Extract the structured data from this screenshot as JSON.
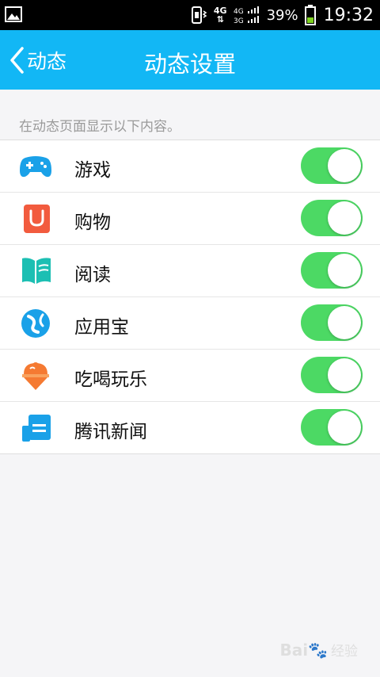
{
  "status_bar": {
    "network_top": "4G",
    "signal_4g": "4G",
    "signal_3g": "3G",
    "battery": "39%",
    "time": "19:32"
  },
  "header": {
    "back_label": "动态",
    "title": "动态设置"
  },
  "hint": "在动态页面显示以下内容。",
  "items": [
    {
      "label": "游戏",
      "icon": "gamepad-icon",
      "color": "#1aa1e8",
      "enabled": true
    },
    {
      "label": "购物",
      "icon": "shopping-bag-icon",
      "color": "#f25b3e",
      "enabled": true
    },
    {
      "label": "阅读",
      "icon": "book-icon",
      "color": "#1cbfb3",
      "enabled": true
    },
    {
      "label": "应用宝",
      "icon": "app-store-icon",
      "color": "#1aa1e8",
      "enabled": true
    },
    {
      "label": "吃喝玩乐",
      "icon": "ice-cream-icon",
      "color": "#f57a32",
      "enabled": true
    },
    {
      "label": "腾讯新闻",
      "icon": "news-icon",
      "color": "#1aa1e8",
      "enabled": true
    }
  ],
  "colors": {
    "header": "#12b7f5",
    "toggle_on": "#4cd964"
  },
  "watermark": {
    "logo": "Bai",
    "text": "经验"
  }
}
